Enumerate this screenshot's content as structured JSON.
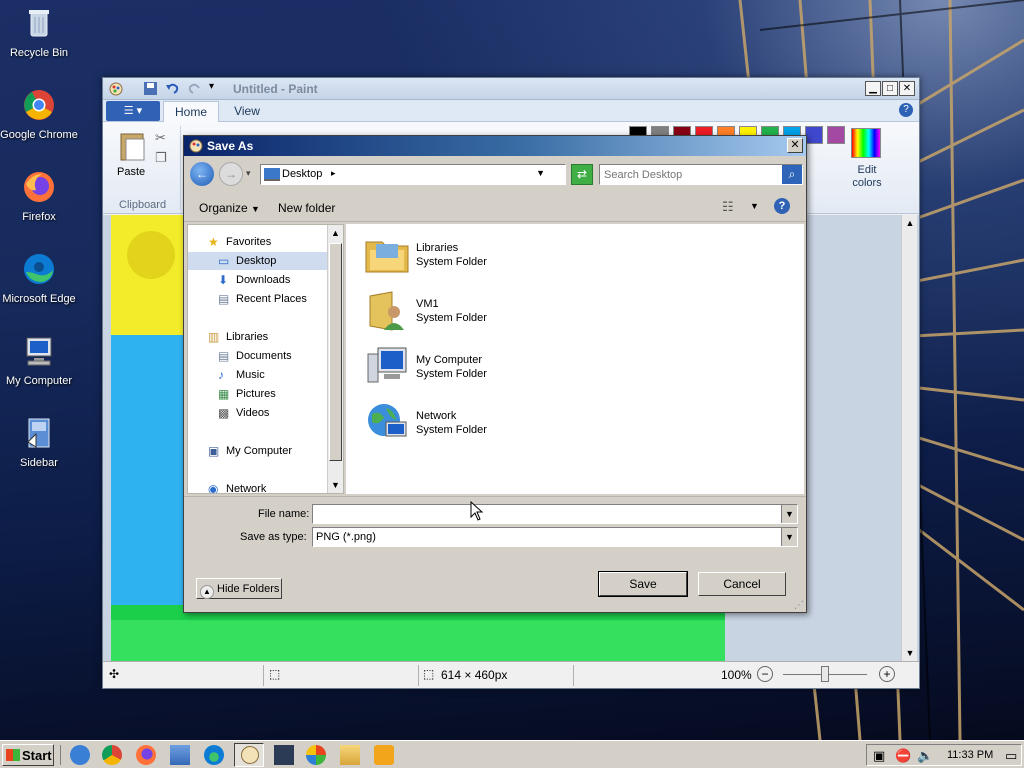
{
  "desktop": {
    "icons": [
      {
        "label": "Recycle Bin",
        "icon": "recycle-bin-icon"
      },
      {
        "label": "Google Chrome",
        "icon": "chrome-icon"
      },
      {
        "label": "Firefox",
        "icon": "firefox-icon"
      },
      {
        "label": "Microsoft Edge",
        "icon": "edge-icon"
      },
      {
        "label": "My Computer",
        "icon": "my-computer-icon"
      },
      {
        "label": "Sidebar",
        "icon": "sidebar-icon"
      }
    ]
  },
  "paint": {
    "title": "Untitled - Paint",
    "tabs": [
      "Home",
      "View"
    ],
    "ribbon": {
      "paste_label": "Paste",
      "clipboard_label": "Clipboard",
      "edit_colors_label": "Edit colors",
      "palette_colors": [
        "#000000",
        "#7f7f7f",
        "#880015",
        "#ed1c24",
        "#ff7f27",
        "#fff200",
        "#22b14c",
        "#00a2e8",
        "#3f48cc",
        "#a349a4",
        "#ffffff",
        "#c3c3c3"
      ]
    },
    "status": {
      "dimensions": "614 × 460px",
      "zoom": "100%",
      "zoom_level": 1.0
    }
  },
  "dialog": {
    "title": "Save As",
    "location": "Desktop",
    "search_placeholder": "Search Desktop",
    "organize_label": "Organize",
    "new_folder_label": "New folder",
    "nav": [
      {
        "label": "Favorites",
        "icon": "star-icon",
        "indent": 0
      },
      {
        "label": "Desktop",
        "icon": "desktop-icon",
        "indent": 1,
        "selected": true
      },
      {
        "label": "Downloads",
        "icon": "downloads-icon",
        "indent": 1
      },
      {
        "label": "Recent Places",
        "icon": "recent-places-icon",
        "indent": 1
      },
      {
        "label": "Libraries",
        "icon": "libraries-icon",
        "indent": 0
      },
      {
        "label": "Documents",
        "icon": "documents-icon",
        "indent": 1
      },
      {
        "label": "Music",
        "icon": "music-icon",
        "indent": 1
      },
      {
        "label": "Pictures",
        "icon": "pictures-icon",
        "indent": 1
      },
      {
        "label": "Videos",
        "icon": "videos-icon",
        "indent": 1
      },
      {
        "label": "My Computer",
        "icon": "my-computer-icon",
        "indent": 0
      },
      {
        "label": "Network",
        "icon": "network-icon",
        "indent": 0
      }
    ],
    "files": [
      {
        "name": "Libraries",
        "type": "System Folder",
        "icon": "libraries-folder-icon"
      },
      {
        "name": "VM1",
        "type": "System Folder",
        "icon": "user-folder-icon"
      },
      {
        "name": "My Computer",
        "type": "System Folder",
        "icon": "computer-icon"
      },
      {
        "name": "Network",
        "type": "System Folder",
        "icon": "network-globe-icon"
      }
    ],
    "file_name_label": "File name:",
    "file_name_value": "",
    "save_type_label": "Save as type:",
    "save_type_value": "PNG (*.png)",
    "hide_folders_label": "Hide Folders",
    "save_label": "Save",
    "cancel_label": "Cancel"
  },
  "taskbar": {
    "start_label": "Start",
    "clock": "11:33 PM"
  }
}
